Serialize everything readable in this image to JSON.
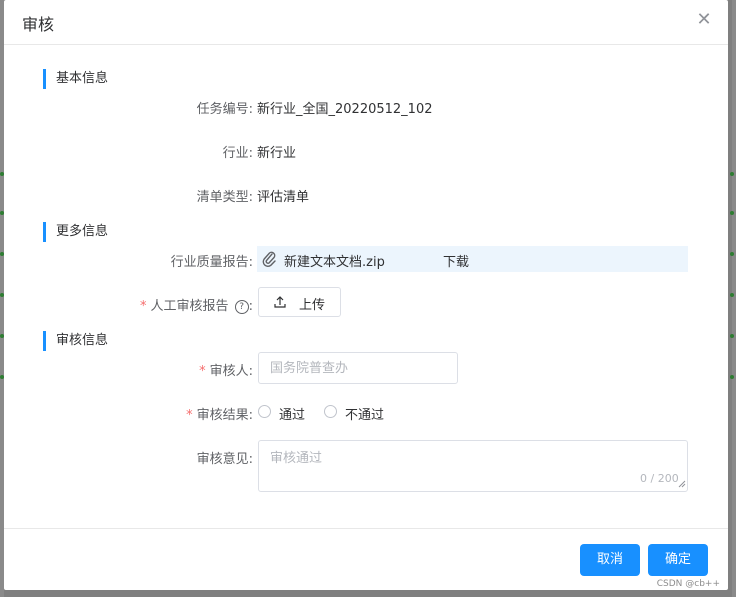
{
  "dialog": {
    "title": "审核"
  },
  "sections": {
    "basic": "基本信息",
    "more": "更多信息",
    "review": "审核信息"
  },
  "basic": {
    "task_label": "任务编号:",
    "task_value": "新行业_全国_20220512_102",
    "industry_label": "行业:",
    "industry_value": "新行业",
    "list_type_label": "清单类型:",
    "list_type_value": "评估清单"
  },
  "more": {
    "quality_report_label": "行业质量报告:",
    "file_name": "新建文本文档.zip",
    "download_label": "下载",
    "manual_report_label": "人工审核报告",
    "manual_report_colon": ":",
    "upload_label": "上传",
    "help_mark": "?"
  },
  "review": {
    "required_mark": "*",
    "reviewer_label": "审核人:",
    "reviewer_placeholder": "国务院普查办",
    "result_label": "审核结果:",
    "options": [
      "通过",
      "不通过"
    ],
    "opinion_label": "审核意见:",
    "opinion_placeholder": "审核通过",
    "word_count": "0 / 200"
  },
  "footer": {
    "cancel_label": "取消",
    "confirm_label": "确定"
  },
  "watermark": "CSDN @cb++",
  "colors": {
    "primary": "#1890ff",
    "required": "#f56c6c",
    "file_row_bg": "#ecf5fd"
  },
  "icons": [
    "close-icon",
    "paperclip-icon",
    "upload-icon",
    "help-circle-icon"
  ]
}
